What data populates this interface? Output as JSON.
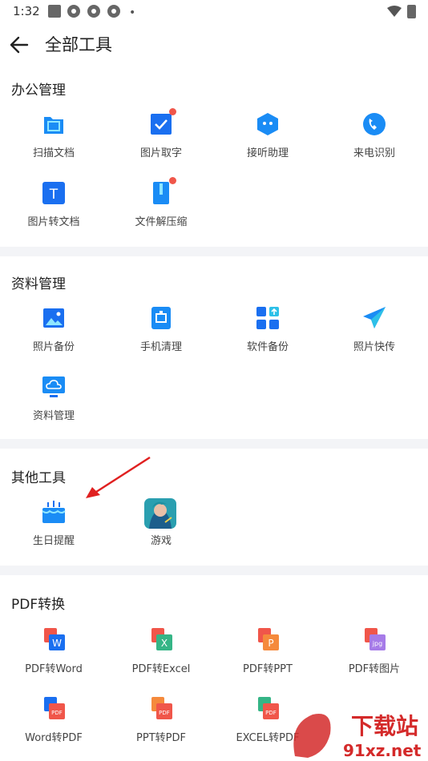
{
  "status_bar": {
    "time": "1:32",
    "dot": "•"
  },
  "header": {
    "title": "全部工具"
  },
  "sections": [
    {
      "title": "办公管理",
      "items": [
        {
          "label": "扫描文档",
          "icon": "scan-icon",
          "badge": false
        },
        {
          "label": "图片取字",
          "icon": "image-text-icon",
          "badge": true
        },
        {
          "label": "接听助理",
          "icon": "answer-assistant-icon",
          "badge": false
        },
        {
          "label": "来电识别",
          "icon": "caller-id-icon",
          "badge": false
        },
        {
          "label": "图片转文档",
          "icon": "image-to-doc-icon",
          "badge": false
        },
        {
          "label": "文件解压缩",
          "icon": "unzip-icon",
          "badge": true
        }
      ]
    },
    {
      "title": "资料管理",
      "items": [
        {
          "label": "照片备份",
          "icon": "photo-backup-icon"
        },
        {
          "label": "手机清理",
          "icon": "phone-clean-icon"
        },
        {
          "label": "软件备份",
          "icon": "app-backup-icon"
        },
        {
          "label": "照片快传",
          "icon": "send-icon"
        },
        {
          "label": "资料管理",
          "icon": "cloud-monitor-icon"
        }
      ]
    },
    {
      "title": "其他工具",
      "items": [
        {
          "label": "生日提醒",
          "icon": "birthday-cake-icon"
        },
        {
          "label": "游戏",
          "icon": "game-avatar-icon"
        }
      ]
    },
    {
      "title": "PDF转换",
      "items": [
        {
          "label": "PDF转Word",
          "icon": "pdf-to-word-icon",
          "tag": "W"
        },
        {
          "label": "PDF转Excel",
          "icon": "pdf-to-excel-icon",
          "tag": "X"
        },
        {
          "label": "PDF转PPT",
          "icon": "pdf-to-ppt-icon",
          "tag": "P"
        },
        {
          "label": "PDF转图片",
          "icon": "pdf-to-image-icon",
          "tag": "jpg"
        },
        {
          "label": "Word转PDF",
          "icon": "word-to-pdf-icon",
          "tag": "PDF"
        },
        {
          "label": "PPT转PDF",
          "icon": "ppt-to-pdf-icon",
          "tag": "PDF"
        },
        {
          "label": "EXCEL转PDF",
          "icon": "excel-to-pdf-icon",
          "tag": "PDF"
        }
      ]
    }
  ],
  "watermark": {
    "line1": "下载站",
    "line2": "91xz.net"
  },
  "colors": {
    "blue": "#1a8cf5",
    "red": "#f0564a",
    "separator": "#f3f4f7"
  }
}
